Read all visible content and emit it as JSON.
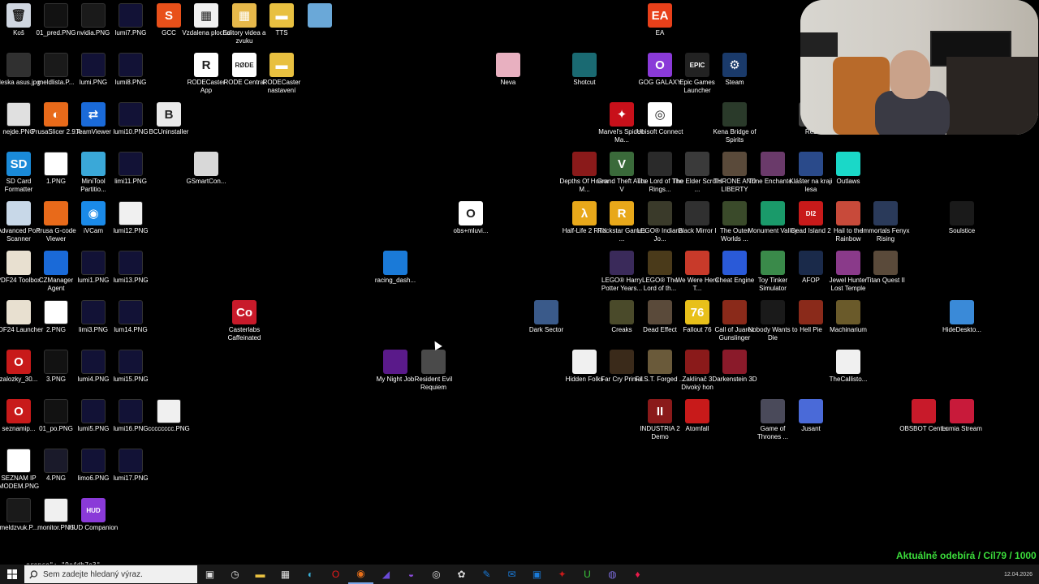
{
  "desktop": {
    "icons": [
      {
        "name": "Koš",
        "color": "#cfd6e0",
        "glyph": "🗑"
      },
      {
        "name": "01_pred.PNG",
        "color": "#121212",
        "glyph": ""
      },
      {
        "name": "nvidia.PNG",
        "color": "#1a1a1a",
        "glyph": ""
      },
      {
        "name": "lumi7.PNG",
        "color": "#121236",
        "glyph": ""
      },
      {
        "name": "GCC",
        "color": "#e8501a",
        "glyph": "S"
      },
      {
        "name": "Vzdalena plocha",
        "color": "#f0f0f0",
        "glyph": "▦"
      },
      {
        "name": "Editory videa a zvuku",
        "color": "#e6b84a",
        "glyph": "▦"
      },
      {
        "name": "TTS",
        "color": "#e8c040",
        "glyph": "▬"
      },
      {
        "name": "",
        "color": "#6aa8d8",
        "glyph": ""
      },
      {
        "name": "EA",
        "color": "#e8401a",
        "glyph": "EA"
      },
      {
        "name": "deska asus.jpg",
        "color": "#303030",
        "glyph": ""
      },
      {
        "name": "meldlista.P...",
        "color": "#1a1a1a",
        "glyph": ""
      },
      {
        "name": "lumi.PNG",
        "color": "#121236",
        "glyph": ""
      },
      {
        "name": "lumi8.PNG",
        "color": "#121236",
        "glyph": ""
      },
      {
        "name": "RODECaster App",
        "color": "#ffffff",
        "glyph": "R"
      },
      {
        "name": "RODE Central",
        "color": "#ffffff",
        "glyph": "RØDE"
      },
      {
        "name": "RODECaster nastavení",
        "color": "#e8c040",
        "glyph": "▬"
      },
      {
        "name": "Neva",
        "color": "#e8b0c0",
        "glyph": ""
      },
      {
        "name": "Shotcut",
        "color": "#1a6a72",
        "glyph": ""
      },
      {
        "name": "GOG GALAXY",
        "color": "#8a3ad8",
        "glyph": "O"
      },
      {
        "name": "Epic Games Launcher",
        "color": "#222",
        "glyph": "EPIC"
      },
      {
        "name": "Steam",
        "color": "#1a3a6a",
        "glyph": "⚙"
      },
      {
        "name": "nejde.PNG",
        "color": "#e0e0e0",
        "glyph": ""
      },
      {
        "name": "PrusaSlicer 2.9.4",
        "color": "#e86a1a",
        "glyph": "◐"
      },
      {
        "name": "TeamViewer",
        "color": "#1a6ad8",
        "glyph": "⇄"
      },
      {
        "name": "lumi10.PNG",
        "color": "#121236",
        "glyph": ""
      },
      {
        "name": "BCUninstaller",
        "color": "#eaeaea",
        "glyph": "B"
      },
      {
        "name": "Marvel's Spider-Ma...",
        "color": "#c8101a",
        "glyph": "✦"
      },
      {
        "name": "Ubisoft Connect",
        "color": "#ffffff",
        "glyph": "◎"
      },
      {
        "name": "Kena Bridge of Spirits",
        "color": "#2a3a2a",
        "glyph": ""
      },
      {
        "name": "Řež",
        "color": "#404040",
        "glyph": ""
      },
      {
        "name": "SD Card Formatter",
        "color": "#1a8ad8",
        "glyph": "SD"
      },
      {
        "name": "1.PNG",
        "color": "#ffffff",
        "glyph": ""
      },
      {
        "name": "MiniTool Partitio...",
        "color": "#3aa8d8",
        "glyph": ""
      },
      {
        "name": "limi11.PNG",
        "color": "#121236",
        "glyph": ""
      },
      {
        "name": "GSmartCon...",
        "color": "#d8d8d8",
        "glyph": ""
      },
      {
        "name": "Depths Of Horror M...",
        "color": "#8a1a1a",
        "glyph": ""
      },
      {
        "name": "Grand Theft Auto V",
        "color": "#3a6a3a",
        "glyph": "V"
      },
      {
        "name": "The Lord of The Rings...",
        "color": "#2a2a2a",
        "glyph": ""
      },
      {
        "name": "The Elder Scrolls ...",
        "color": "#3a3a3a",
        "glyph": ""
      },
      {
        "name": "THRONE AND LIBERTY",
        "color": "#5a4a3a",
        "glyph": ""
      },
      {
        "name": "Trine Enchante...",
        "color": "#6a3a6a",
        "glyph": ""
      },
      {
        "name": "Klášter na kraji lesa",
        "color": "#2a4a8a",
        "glyph": ""
      },
      {
        "name": "Outlaws",
        "color": "#1ad8c8",
        "glyph": ""
      },
      {
        "name": "Advanced Port Scanner",
        "color": "#c8d8e8",
        "glyph": ""
      },
      {
        "name": "Prusa G-code Viewer",
        "color": "#e86a1a",
        "glyph": ""
      },
      {
        "name": "iVCam",
        "color": "#1a8ae8",
        "glyph": "◉"
      },
      {
        "name": "lumi12.PNG",
        "color": "#f0f0f0",
        "glyph": ""
      },
      {
        "name": "obs+mluvi...",
        "color": "#ffffff",
        "glyph": "O"
      },
      {
        "name": "Half-Life 2 RTX",
        "color": "#e8a81a",
        "glyph": "λ"
      },
      {
        "name": "Rockstar Games ...",
        "color": "#e8a81a",
        "glyph": "R"
      },
      {
        "name": "LEGO® Indiana Jo...",
        "color": "#3a3a2a",
        "glyph": ""
      },
      {
        "name": "Black Mirror I",
        "color": "#303030",
        "glyph": ""
      },
      {
        "name": "The Outer Worlds ...",
        "color": "#3a4a2a",
        "glyph": ""
      },
      {
        "name": "Monument Valley",
        "color": "#1a9a6a",
        "glyph": ""
      },
      {
        "name": "Dead Island 2",
        "color": "#c81a1a",
        "glyph": "DI2"
      },
      {
        "name": "Hail to the Rainbow",
        "color": "#c84a3a",
        "glyph": ""
      },
      {
        "name": "Immortals Fenyx Rising",
        "color": "#2a3a5a",
        "glyph": ""
      },
      {
        "name": "Soulstice",
        "color": "#1a1a1a",
        "glyph": ""
      },
      {
        "name": "PDF24 Toolbox",
        "color": "#e8e0d0",
        "glyph": ""
      },
      {
        "name": "CZManager Agent",
        "color": "#1a6ad8",
        "glyph": ""
      },
      {
        "name": "lumi1.PNG",
        "color": "#121236",
        "glyph": ""
      },
      {
        "name": "lumi13.PNG",
        "color": "#121236",
        "glyph": ""
      },
      {
        "name": "racing_dash...",
        "color": "#1a7ad8",
        "glyph": ""
      },
      {
        "name": "LEGO® Harry Potter Years...",
        "color": "#3a2a5a",
        "glyph": ""
      },
      {
        "name": "LEGO® The Lord of th...",
        "color": "#4a3a1a",
        "glyph": ""
      },
      {
        "name": "We Were Here T...",
        "color": "#c83a2a",
        "glyph": ""
      },
      {
        "name": "Cheat Engine",
        "color": "#2a5ad8",
        "glyph": ""
      },
      {
        "name": "Toy Tinker Simulator",
        "color": "#3a8a4a",
        "glyph": ""
      },
      {
        "name": "AFOP",
        "color": "#1a2a4a",
        "glyph": ""
      },
      {
        "name": "Jewel Hunter Lost Temple",
        "color": "#8a3a8a",
        "glyph": ""
      },
      {
        "name": "Titan Quest II",
        "color": "#5a4a3a",
        "glyph": ""
      },
      {
        "name": "PDF24 Launcher",
        "color": "#e8e0d0",
        "glyph": ""
      },
      {
        "name": "2.PNG",
        "color": "#ffffff",
        "glyph": ""
      },
      {
        "name": "limi3.PNG",
        "color": "#121236",
        "glyph": ""
      },
      {
        "name": "lum14.PNG",
        "color": "#121236",
        "glyph": ""
      },
      {
        "name": "Casterlabs Caffeinated",
        "color": "#c81a2a",
        "glyph": "Co"
      },
      {
        "name": "Dark Sector",
        "color": "#3a5a8a",
        "glyph": ""
      },
      {
        "name": "Creaks",
        "color": "#4a4a2a",
        "glyph": ""
      },
      {
        "name": "Dead Effect",
        "color": "#5a4a3a",
        "glyph": ""
      },
      {
        "name": "Fallout 76",
        "color": "#e8c01a",
        "glyph": "76"
      },
      {
        "name": "Call of Juarez Gunslinger",
        "color": "#8a2a1a",
        "glyph": ""
      },
      {
        "name": "Nobody Wants to Die",
        "color": "#1a1a1a",
        "glyph": ""
      },
      {
        "name": "Hell Pie",
        "color": "#8a2a1a",
        "glyph": ""
      },
      {
        "name": "Machinarium",
        "color": "#6a5a2a",
        "glyph": ""
      },
      {
        "name": "HideDeskto...",
        "color": "#3a8ad8",
        "glyph": ""
      },
      {
        "name": "zalozky_30...",
        "color": "#c81a1a",
        "glyph": "O"
      },
      {
        "name": "3.PNG",
        "color": "#121212",
        "glyph": ""
      },
      {
        "name": "lumi4.PNG",
        "color": "#121236",
        "glyph": ""
      },
      {
        "name": "lumi15.PNG",
        "color": "#121236",
        "glyph": ""
      },
      {
        "name": "My Night Job",
        "color": "#5a1a8a",
        "glyph": ""
      },
      {
        "name": "Resident Evil Requiem",
        "color": "#4a4a4a",
        "glyph": ""
      },
      {
        "name": "Hidden Folks",
        "color": "#f0f0f0",
        "glyph": ""
      },
      {
        "name": "Far Cry Primal",
        "color": "#3a2a1a",
        "glyph": ""
      },
      {
        "name": "F.I.S.T. Forged ...",
        "color": "#6a5a3a",
        "glyph": ""
      },
      {
        "name": "Zaklínač 3 Divoký hon",
        "color": "#8a1a1a",
        "glyph": ""
      },
      {
        "name": "Darkenstein 3D",
        "color": "#8a1a2a",
        "glyph": ""
      },
      {
        "name": "TheCallisto...",
        "color": "#f0f0f0",
        "glyph": ""
      },
      {
        "name": "seznamip...",
        "color": "#c81a1a",
        "glyph": "O"
      },
      {
        "name": "01_po.PNG",
        "color": "#121212",
        "glyph": ""
      },
      {
        "name": "lumi5.PNG",
        "color": "#121236",
        "glyph": ""
      },
      {
        "name": "lumi16.PNG",
        "color": "#121236",
        "glyph": ""
      },
      {
        "name": "cccccccc.PNG",
        "color": "#f0f0f0",
        "glyph": ""
      },
      {
        "name": "INDUSTRIA 2 Demo",
        "color": "#8a1a1a",
        "glyph": "II"
      },
      {
        "name": "Atomfall",
        "color": "#c81a1a",
        "glyph": ""
      },
      {
        "name": "Game of Thrones ...",
        "color": "#4a4a5a",
        "glyph": ""
      },
      {
        "name": "Jusant",
        "color": "#4a6ad8",
        "glyph": ""
      },
      {
        "name": "OBSBOT Center",
        "color": "#c81a2a",
        "glyph": ""
      },
      {
        "name": "Lumia Stream",
        "color": "#c81a3a",
        "glyph": ""
      },
      {
        "name": "SEZNAM IP MODEM.PNG",
        "color": "#ffffff",
        "glyph": ""
      },
      {
        "name": "4.PNG",
        "color": "#1a1a2a",
        "glyph": ""
      },
      {
        "name": "limo6.PNG",
        "color": "#121236",
        "glyph": ""
      },
      {
        "name": "lumi17.PNG",
        "color": "#121236",
        "glyph": ""
      },
      {
        "name": "meldzvuk.P...",
        "color": "#1a1a1a",
        "glyph": ""
      },
      {
        "name": "monitor.PNG",
        "color": "#f0f0f0",
        "glyph": ""
      },
      {
        "name": "HUD Companion",
        "color": "#8a3ad8",
        "glyph": "HUD"
      }
    ]
  },
  "overlay": {
    "subgoal_text": "Aktuálně odebírá / Cíl79 / 1000",
    "progress_fraction": 0.079,
    "debug_text": "erence\": \"9e4db7e3\""
  },
  "taskbar": {
    "search_placeholder": "Sem zadejte hledaný výraz.",
    "apps": [
      {
        "name": "task-view",
        "glyph": "▣",
        "color": "#ddd"
      },
      {
        "name": "clock-app",
        "glyph": "◷",
        "color": "#ddd"
      },
      {
        "name": "file-explorer",
        "glyph": "▬",
        "color": "#e8c040"
      },
      {
        "name": "store",
        "glyph": "▦",
        "color": "#ddd"
      },
      {
        "name": "edge",
        "glyph": "◐",
        "color": "#3ab0d8"
      },
      {
        "name": "opera",
        "glyph": "O",
        "color": "#e81a1a"
      },
      {
        "name": "firefox",
        "glyph": "◉",
        "color": "#e8701a",
        "active": true
      },
      {
        "name": "app-blue",
        "glyph": "◢",
        "color": "#6a4ad8"
      },
      {
        "name": "app-purple",
        "glyph": "◒",
        "color": "#8a4ad8"
      },
      {
        "name": "obs",
        "glyph": "◎",
        "color": "#ddd"
      },
      {
        "name": "app-bird",
        "glyph": "✿",
        "color": "#ddd"
      },
      {
        "name": "app-pen",
        "glyph": "✎",
        "color": "#1a7ad8"
      },
      {
        "name": "app-mail",
        "glyph": "✉",
        "color": "#1a7ad8"
      },
      {
        "name": "app-save",
        "glyph": "▣",
        "color": "#1a7ad8"
      },
      {
        "name": "app-red",
        "glyph": "✦",
        "color": "#c81a1a"
      },
      {
        "name": "app-u",
        "glyph": "U",
        "color": "#3ac83a"
      },
      {
        "name": "app-glow",
        "glyph": "◍",
        "color": "#7a6ad8"
      },
      {
        "name": "app-pin",
        "glyph": "♦",
        "color": "#e81a4a"
      }
    ],
    "clock_text": "12.04.2026"
  }
}
